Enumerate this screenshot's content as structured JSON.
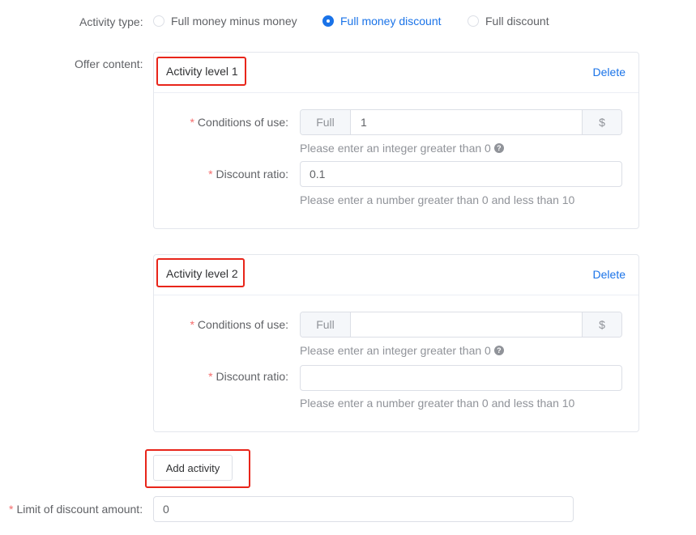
{
  "activity_type": {
    "label": "Activity type:",
    "options": [
      {
        "label": "Full money minus money",
        "checked": false
      },
      {
        "label": "Full money discount",
        "checked": true
      },
      {
        "label": "Full discount",
        "checked": false
      }
    ]
  },
  "offer_content": {
    "label": "Offer content:",
    "levels": [
      {
        "title": "Activity level 1",
        "delete_label": "Delete",
        "conditions_label": "Conditions of use:",
        "prepend": "Full",
        "condition_value": "1",
        "append": "$",
        "condition_hint": "Please enter an integer greater than 0",
        "ratio_label": "Discount ratio:",
        "ratio_value": "0.1",
        "ratio_hint": "Please enter a number greater than 0 and less than 10"
      },
      {
        "title": "Activity level 2",
        "delete_label": "Delete",
        "conditions_label": "Conditions of use:",
        "prepend": "Full",
        "condition_value": "",
        "append": "$",
        "condition_hint": "Please enter an integer greater than 0",
        "ratio_label": "Discount ratio:",
        "ratio_value": "",
        "ratio_hint": "Please enter a number greater than 0 and less than 10"
      }
    ]
  },
  "add_activity_label": "Add activity",
  "limit": {
    "label": "Limit of discount amount:",
    "value": "0"
  },
  "colors": {
    "accent": "#1a73e8",
    "required": "#f56c6c",
    "highlight": "#e8251a"
  },
  "icons": {
    "help": "question-circle-icon"
  }
}
